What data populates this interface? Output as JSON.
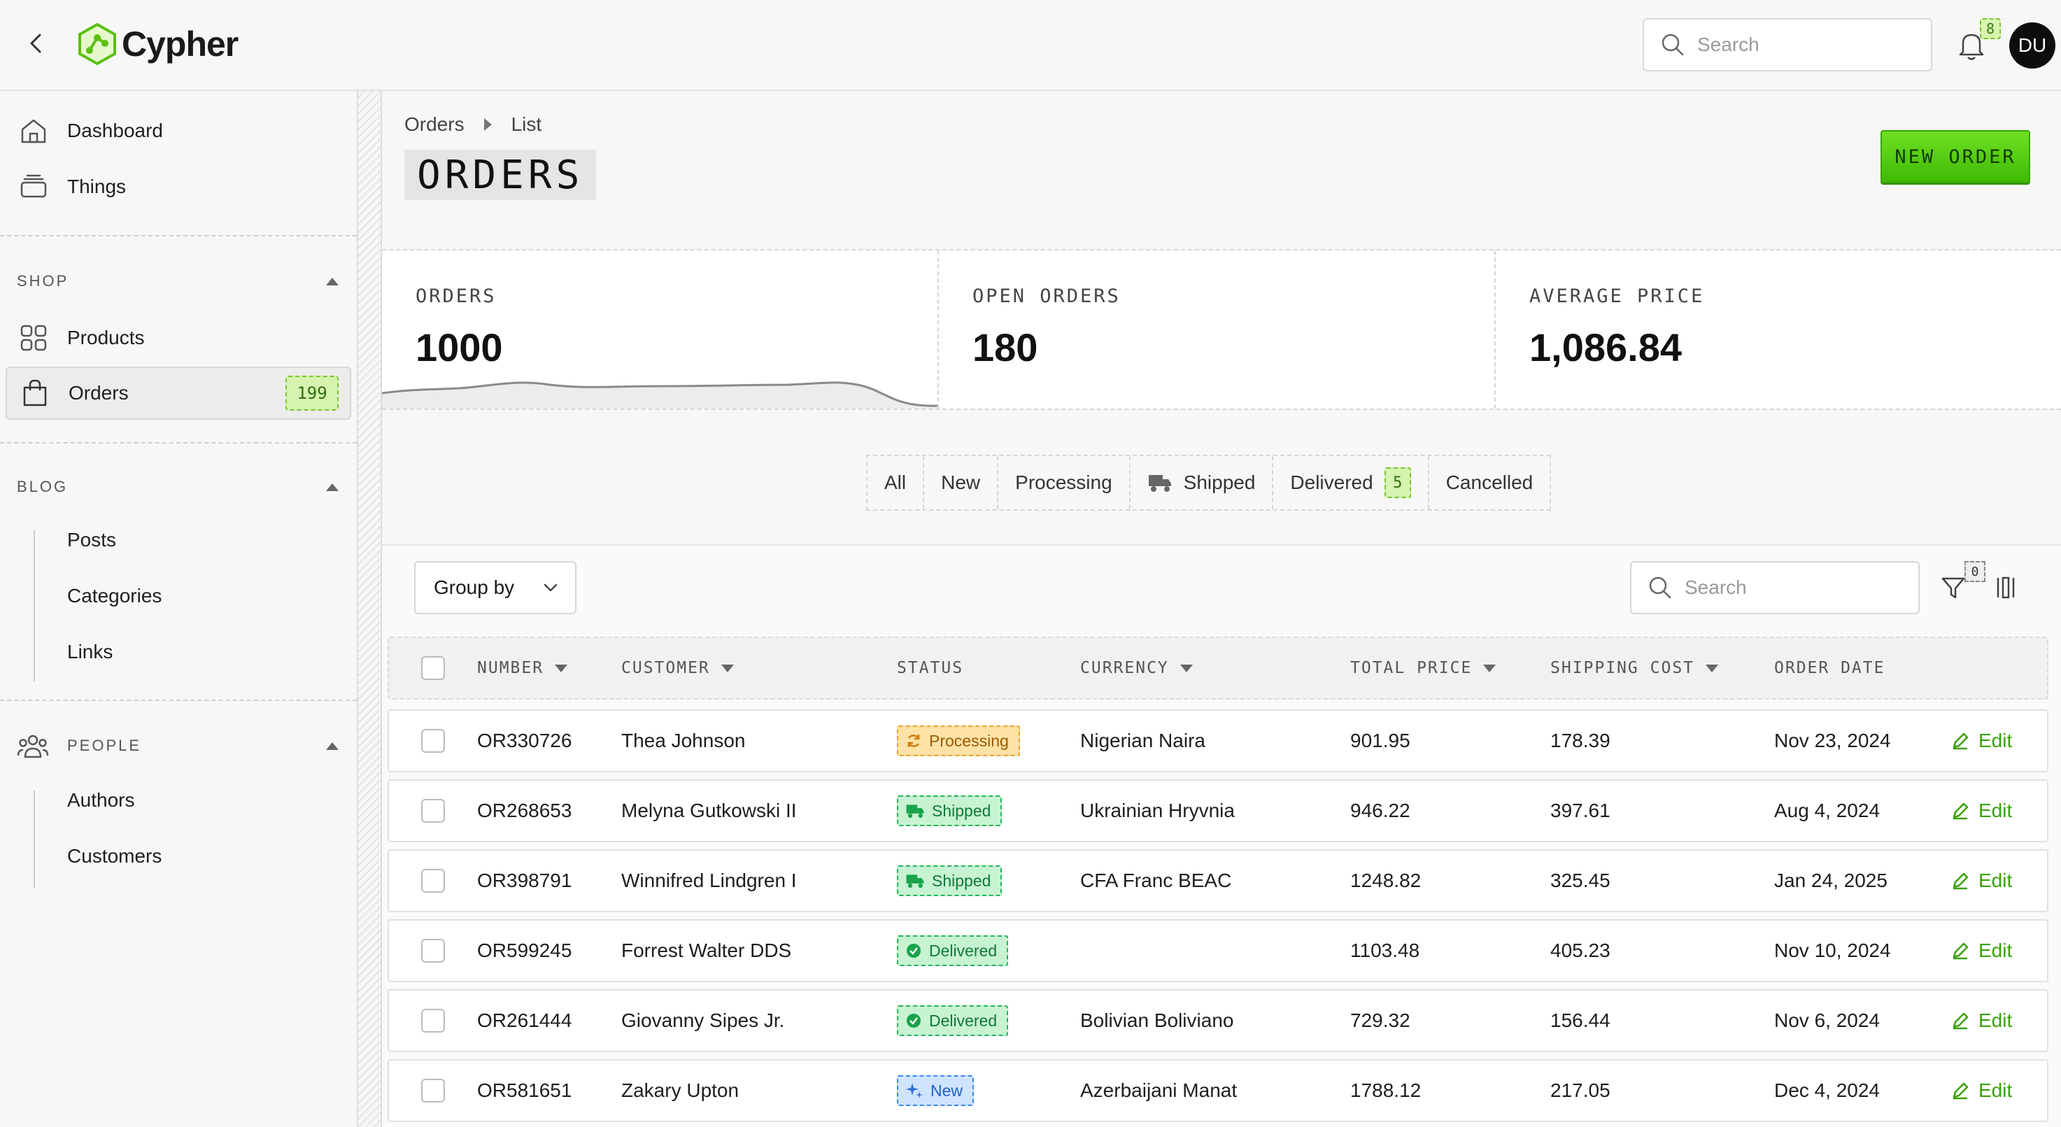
{
  "app": {
    "name": "Cypher",
    "notifications_count": "8",
    "avatar_initials": "DU",
    "search_placeholder": "Search"
  },
  "sidebar": {
    "top_items": [
      {
        "label": "Dashboard",
        "icon": "home-icon"
      },
      {
        "label": "Things",
        "icon": "stack-icon"
      }
    ],
    "sections": [
      {
        "title": "SHOP",
        "items": [
          {
            "label": "Products",
            "icon": "grid-icon"
          },
          {
            "label": "Orders",
            "icon": "bag-icon",
            "badge": "199",
            "active": true
          }
        ]
      },
      {
        "title": "BLOG",
        "items": [
          {
            "label": "Posts"
          },
          {
            "label": "Categories"
          },
          {
            "label": "Links"
          }
        ]
      },
      {
        "title": "PEOPLE",
        "icon": "people-icon",
        "items": [
          {
            "label": "Authors"
          },
          {
            "label": "Customers"
          }
        ]
      }
    ]
  },
  "header": {
    "breadcrumb": [
      "Orders",
      "List"
    ],
    "title": "ORDERS",
    "new_order_label": "NEW ORDER"
  },
  "stats": [
    {
      "label": "ORDERS",
      "value": "1000"
    },
    {
      "label": "OPEN ORDERS",
      "value": "180"
    },
    {
      "label": "AVERAGE PRICE",
      "value": "1,086.84"
    }
  ],
  "tabs": [
    {
      "label": "All"
    },
    {
      "label": "New"
    },
    {
      "label": "Processing"
    },
    {
      "label": "Shipped",
      "icon": "truck-icon"
    },
    {
      "label": "Delivered",
      "badge": "5"
    },
    {
      "label": "Cancelled"
    }
  ],
  "table": {
    "group_by_label": "Group by",
    "search_placeholder": "Search",
    "filter_count": "0",
    "columns": [
      "NUMBER",
      "CUSTOMER",
      "STATUS",
      "CURRENCY",
      "TOTAL PRICE",
      "SHIPPING COST",
      "ORDER DATE"
    ],
    "edit_label": "Edit",
    "rows": [
      {
        "number": "OR330726",
        "customer": "Thea Johnson",
        "status": "Processing",
        "currency": "Nigerian Naira",
        "total": "901.95",
        "shipping": "178.39",
        "date": "Nov 23, 2024"
      },
      {
        "number": "OR268653",
        "customer": "Melyna Gutkowski II",
        "status": "Shipped",
        "currency": "Ukrainian Hryvnia",
        "total": "946.22",
        "shipping": "397.61",
        "date": "Aug 4, 2024"
      },
      {
        "number": "OR398791",
        "customer": "Winnifred Lindgren I",
        "status": "Shipped",
        "currency": "CFA Franc BEAC",
        "total": "1248.82",
        "shipping": "325.45",
        "date": "Jan 24, 2025"
      },
      {
        "number": "OR599245",
        "customer": "Forrest Walter DDS",
        "status": "Delivered",
        "currency": "",
        "total": "1103.48",
        "shipping": "405.23",
        "date": "Nov 10, 2024"
      },
      {
        "number": "OR261444",
        "customer": "Giovanny Sipes Jr.",
        "status": "Delivered",
        "currency": "Bolivian Boliviano",
        "total": "729.32",
        "shipping": "156.44",
        "date": "Nov 6, 2024"
      },
      {
        "number": "OR581651",
        "customer": "Zakary Upton",
        "status": "New",
        "currency": "Azerbaijani Manat",
        "total": "1788.12",
        "shipping": "217.05",
        "date": "Dec 4, 2024"
      }
    ]
  }
}
